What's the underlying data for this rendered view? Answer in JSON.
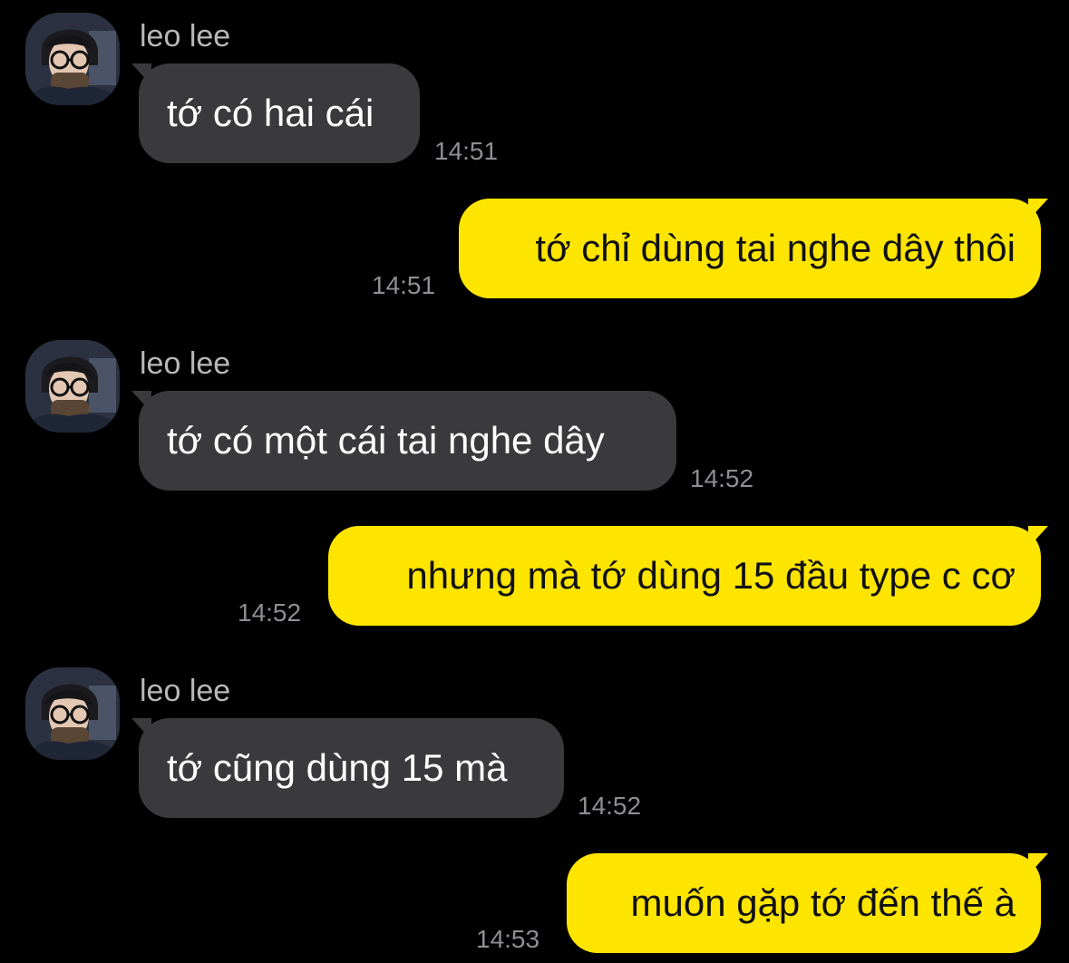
{
  "chat": {
    "sender_name": "leo lee",
    "colors": {
      "background": "#000000",
      "incoming_bubble": "#3a3a3c",
      "outgoing_bubble": "#fee500",
      "timestamp": "#8e8e93",
      "sender_name": "#b8b8b8"
    },
    "messages": [
      {
        "direction": "incoming",
        "sender": "leo lee",
        "text": "tớ có hai cái",
        "time": "14:51"
      },
      {
        "direction": "outgoing",
        "text": "tớ chỉ dùng tai nghe dây thôi",
        "time": "14:51"
      },
      {
        "direction": "incoming",
        "sender": "leo lee",
        "text": "tớ có một cái tai nghe dây",
        "time": "14:52"
      },
      {
        "direction": "outgoing",
        "text": "nhưng mà tớ dùng 15 đầu type c cơ",
        "time": "14:52"
      },
      {
        "direction": "incoming",
        "sender": "leo lee",
        "text": "tớ cũng dùng 15 mà",
        "time": "14:52"
      },
      {
        "direction": "outgoing",
        "text": "muốn gặp tớ đến thế à",
        "time": "14:53"
      }
    ]
  }
}
